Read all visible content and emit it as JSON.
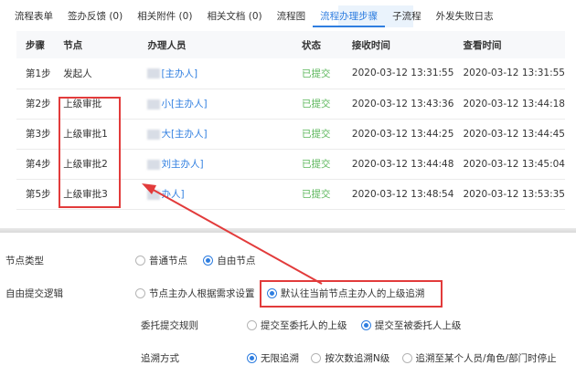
{
  "tabs": [
    {
      "label": "流程表单"
    },
    {
      "label": "签办反馈 (0)"
    },
    {
      "label": "相关附件 (0)"
    },
    {
      "label": "相关文档 (0)"
    },
    {
      "label": "流程图"
    },
    {
      "label": "流程办理步骤"
    },
    {
      "label": "子流程"
    },
    {
      "label": "外发失败日志"
    }
  ],
  "table": {
    "headers": [
      "步骤",
      "节点",
      "办理人员",
      "状态",
      "接收时间",
      "查看时间"
    ],
    "rows": [
      {
        "step": "第1步",
        "node": "发起人",
        "handler": "[主办人]",
        "status": "已提交",
        "recv": "2020-03-12 13:31:55",
        "view": "2020-03-12 13:31:55"
      },
      {
        "step": "第2步",
        "node": "上级审批",
        "handler": "小[主办人]",
        "status": "已提交",
        "recv": "2020-03-12 13:43:36",
        "view": "2020-03-12 13:44:18"
      },
      {
        "step": "第3步",
        "node": "上级审批1",
        "handler": "大[主办人]",
        "status": "已提交",
        "recv": "2020-03-12 13:44:25",
        "view": "2020-03-12 13:44:45"
      },
      {
        "step": "第4步",
        "node": "上级审批2",
        "handler": "刘主办人]",
        "status": "已提交",
        "recv": "2020-03-12 13:44:48",
        "view": "2020-03-12 13:45:04"
      },
      {
        "step": "第5步",
        "node": "上级审批3",
        "handler": "办人]",
        "status": "已提交",
        "recv": "2020-03-12 13:48:54",
        "view": "2020-03-12 13:53:35"
      }
    ]
  },
  "form": {
    "node_type_label": "节点类型",
    "node_type_opts": [
      "普通节点",
      "自由节点"
    ],
    "free_logic_label": "自由提交逻辑",
    "free_logic_opts": [
      "节点主办人根据需求设置",
      "默认往当前节点主办人的上级追溯"
    ],
    "delegate_label": "委托提交规则",
    "delegate_opts": [
      "提交至委托人的上级",
      "提交至被委托人上级"
    ],
    "trace_label": "追溯方式",
    "trace_opts": [
      "无限追溯",
      "按次数追溯N级",
      "追溯至某个人员/角色/部门时停止"
    ]
  },
  "colors": {
    "accent": "#2f7ee0",
    "success": "#5ab65a",
    "annotation": "#e23b3b"
  }
}
